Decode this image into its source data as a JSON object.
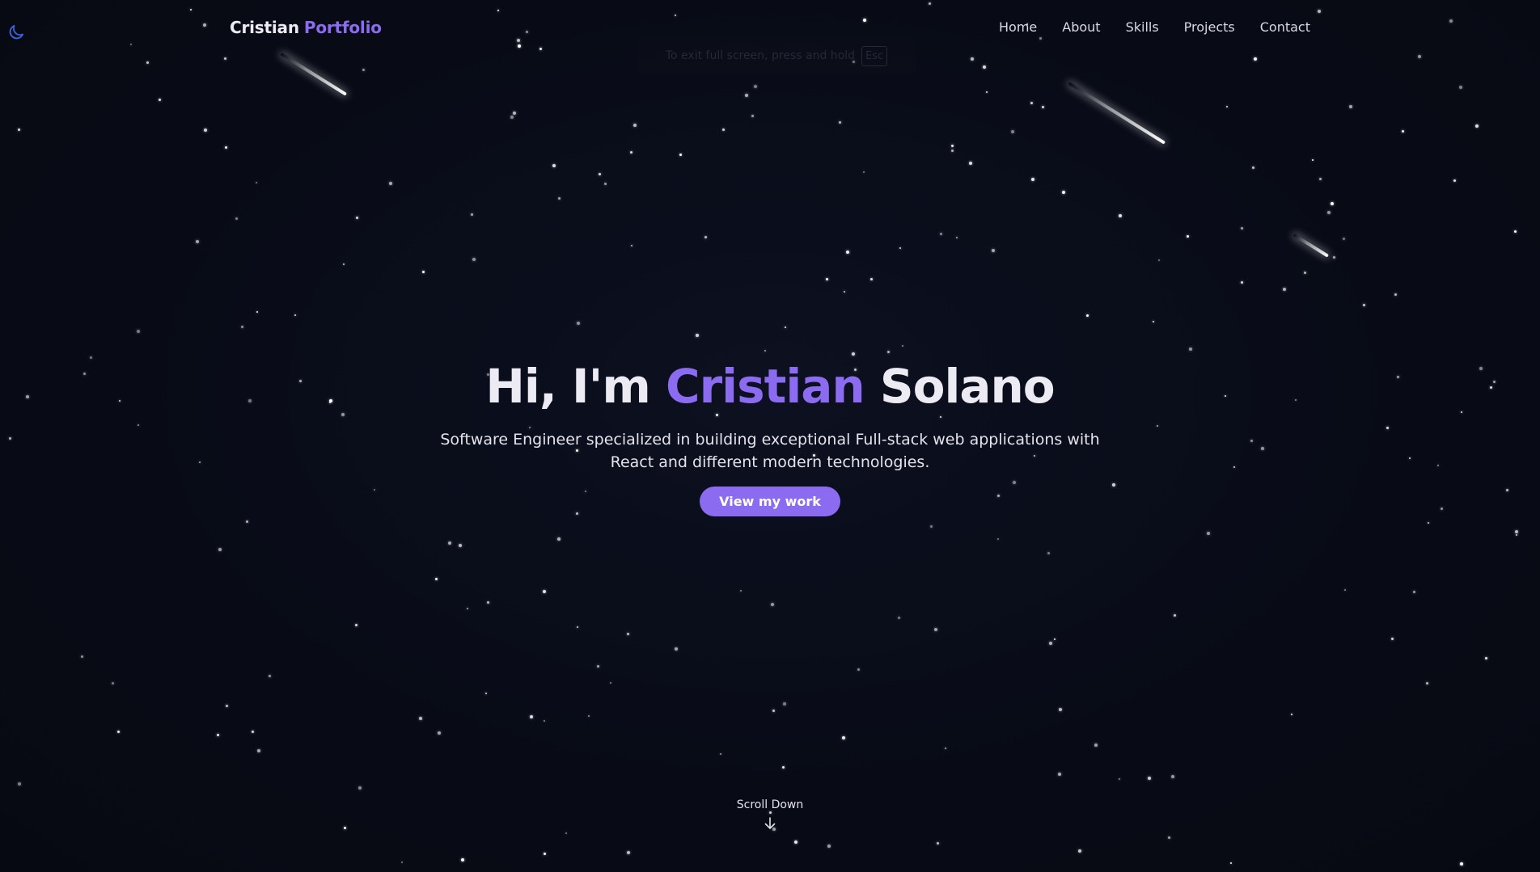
{
  "theme": {
    "background": "#080b16",
    "accent": "#8b6cf0",
    "text": "#ecebf3",
    "toggle_icon": "moon-icon"
  },
  "brand": {
    "first": "Cristian",
    "second": "Portfolio"
  },
  "nav": {
    "items": [
      {
        "label": "Home"
      },
      {
        "label": "About"
      },
      {
        "label": "Skills"
      },
      {
        "label": "Projects"
      },
      {
        "label": "Contact"
      }
    ]
  },
  "fullscreen_notice": {
    "text": "To exit full screen, press and hold",
    "key": "Esc"
  },
  "hero": {
    "greeting": "Hi, I'm",
    "first_name": "Cristian",
    "last_name": "Solano",
    "tagline": "Software Engineer specialized in building exceptional Full-stack web applications with React and different modern technologies.",
    "cta_label": "View my work"
  },
  "scroll": {
    "label": "Scroll Down",
    "icon": "arrow-down-icon"
  }
}
